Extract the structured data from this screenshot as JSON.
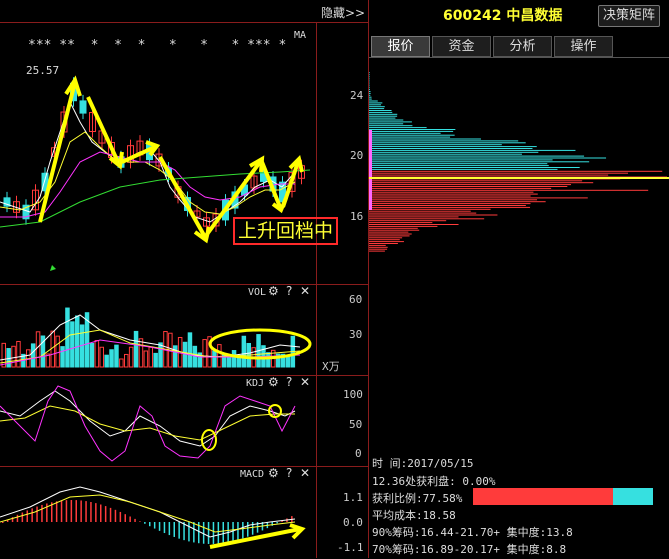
{
  "toolbar": {
    "hide_label": "隐藏>>",
    "decision_button": "决策矩阵"
  },
  "stock": {
    "code": "600242",
    "name": "中昌数据"
  },
  "tabs": [
    {
      "label": "报价",
      "active": true
    },
    {
      "label": "资金",
      "active": false
    },
    {
      "label": "分析",
      "active": false
    },
    {
      "label": "操作",
      "active": false
    }
  ],
  "main_chart": {
    "ma_label": "MA",
    "stars": "*** **  *  *  *   *   *   * *** *",
    "high_label": "25.57",
    "annotation": "上升回档中"
  },
  "vol": {
    "title": "VOL",
    "axis": [
      "60",
      "30",
      "X万"
    ],
    "settings": "⚙",
    "help": "?",
    "close": "✕"
  },
  "kdj": {
    "title": "KDJ",
    "axis": [
      "100",
      "50",
      "0"
    ],
    "settings": "⚙",
    "help": "?",
    "close": "✕"
  },
  "macd": {
    "title": "MACD",
    "axis": [
      "1.1",
      "0.0",
      "-1.1"
    ],
    "settings": "⚙",
    "help": "?",
    "close": "✕"
  },
  "chip_axis": [
    "24",
    "20",
    "16"
  ],
  "info": {
    "time_label": "时        间:2017/05/15",
    "profit_disk": "12.36处获利盘: 0.00%",
    "profit_ratio": "获利比例:77.58%",
    "avg_cost": "平均成本:18.58",
    "chip90": "90%筹码:16.44-21.70+ 集中度:13.8",
    "chip70": "70%筹码:16.89-20.17+ 集中度:8.8"
  },
  "colors": {
    "up": "#ff3b3b",
    "down": "#36e0e0",
    "ma5": "#ffffff",
    "ma10": "#ffff33",
    "ma20": "#ff33ff",
    "ma60": "#33dd33",
    "arrow": "#ffff00"
  }
}
